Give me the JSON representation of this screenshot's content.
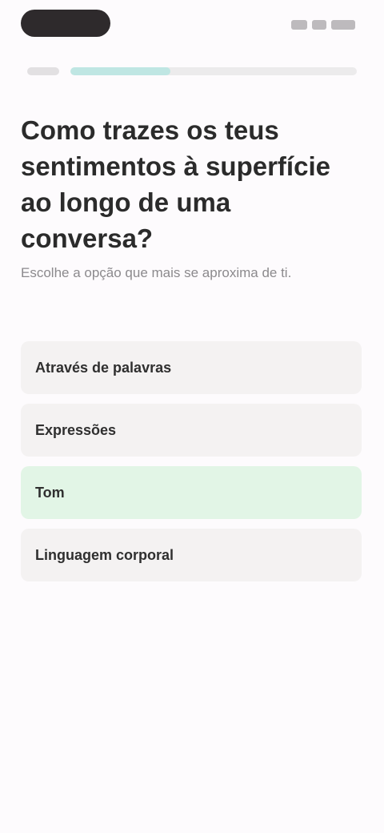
{
  "progress": {
    "fraction": 0.35
  },
  "question": {
    "title": "Como trazes os teus sentimentos à superfície ao longo de uma conversa?",
    "subtitle": "Escolhe a opção que mais se aproxima de ti."
  },
  "options": [
    {
      "label": "Através de palavras",
      "selected": false
    },
    {
      "label": "Expressões",
      "selected": false
    },
    {
      "label": "Tom",
      "selected": true
    },
    {
      "label": "Linguagem corporal",
      "selected": false
    }
  ],
  "colors": {
    "progress_fill": "#bfe6e3",
    "selected_option": "#e2f5e6",
    "option_bg": "#f4f2f2"
  }
}
